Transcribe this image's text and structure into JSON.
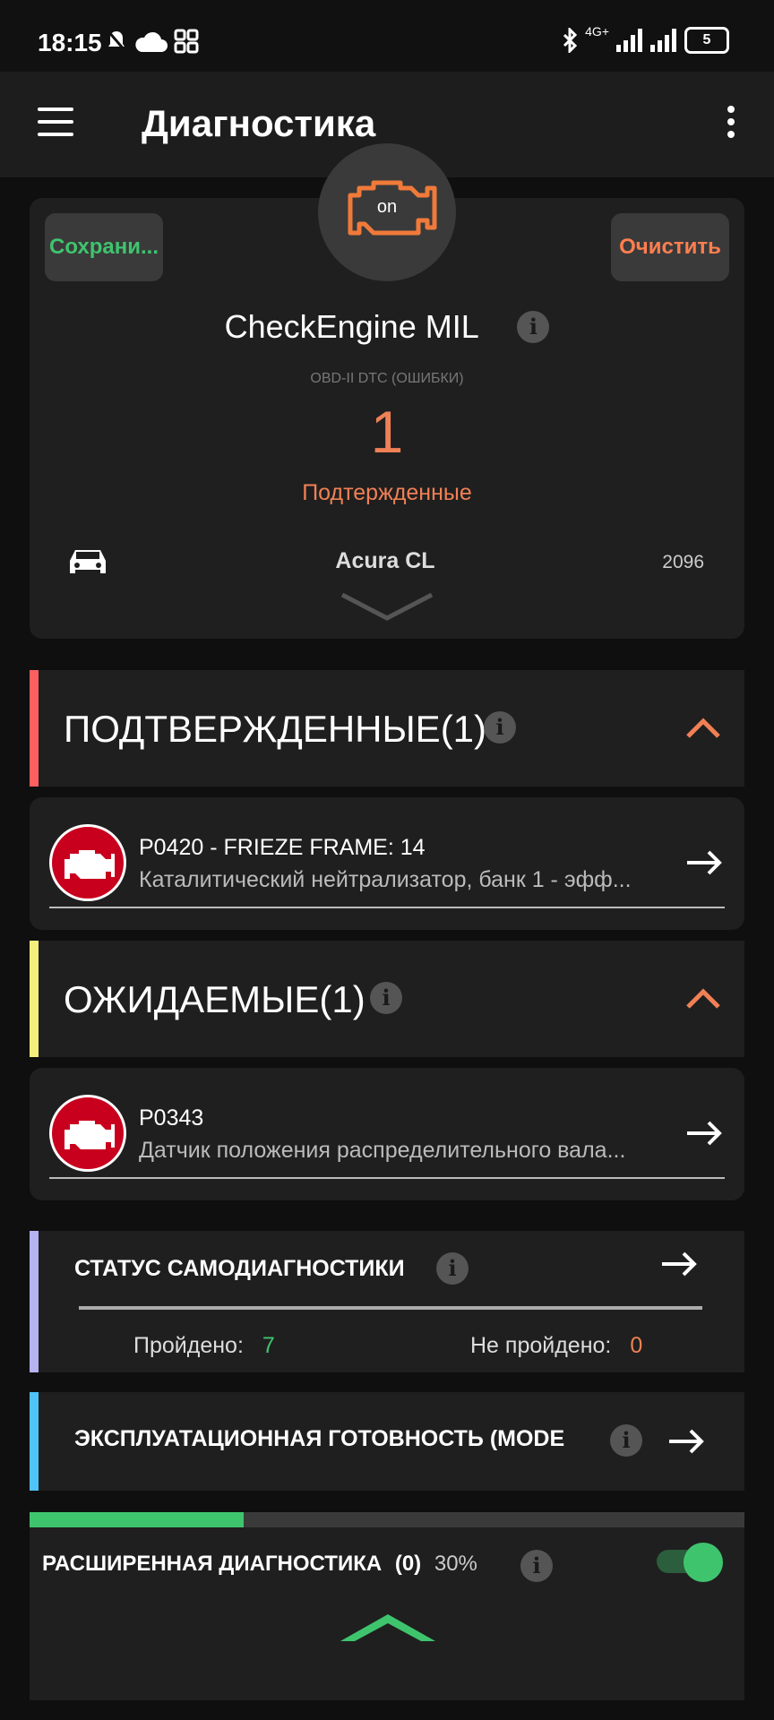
{
  "status_bar": {
    "time": "18:15",
    "network": "4G+",
    "battery": "5",
    "icons": [
      "silent-icon",
      "cloud-icon",
      "apps-icon",
      "bluetooth-icon",
      "signal-icon",
      "signal-icon"
    ]
  },
  "app_bar": {
    "title": "Диагностика",
    "menu_icon": "hamburger-icon",
    "overflow_icon": "more-vertical-icon"
  },
  "hero": {
    "engine_status": "on",
    "save_label": "Сохрани...",
    "clear_label": "Очистить",
    "title": "CheckEngine MIL",
    "subtitle": "OBD-II DTC (ОШИБКИ)",
    "count": "1",
    "state": "Подтержденные",
    "car_name": "Acura CL",
    "car_year": "2096",
    "colors": {
      "save": "#3fc46e",
      "clear": "#ff7e4f",
      "count": "#f08055"
    }
  },
  "confirmed": {
    "title": "ПОДТВЕРЖДЕННЫЕ(1)",
    "color": "#ff5f5f",
    "item": {
      "code": "P0420 - FRIEZE FRAME: 14",
      "description": "Каталитический нейтрализатор, банк 1 - эфф..."
    }
  },
  "pending": {
    "title": "ОЖИДАЕМЫЕ(1)",
    "color": "#f3ee7c",
    "item": {
      "code": "P0343",
      "description": "Датчик положения распределительного вала..."
    }
  },
  "self_diag": {
    "title": "СТАТУС САМОДИАГНОСТИКИ",
    "color": "#b5b3f0",
    "passed_label": "Пройдено:",
    "passed_value": "7",
    "failed_label": "Не пройдено:",
    "failed_value": "0"
  },
  "readiness": {
    "title": "ЭКСПЛУАТАЦИОННАЯ ГОТОВНОСТЬ (MODE",
    "color": "#4fc3f7"
  },
  "extended": {
    "title": "РАСШИРЕННАЯ ДИАГНОСТИКА",
    "count": "(0)",
    "percent": "30%",
    "progress": 0.3,
    "toggle_on": true
  }
}
